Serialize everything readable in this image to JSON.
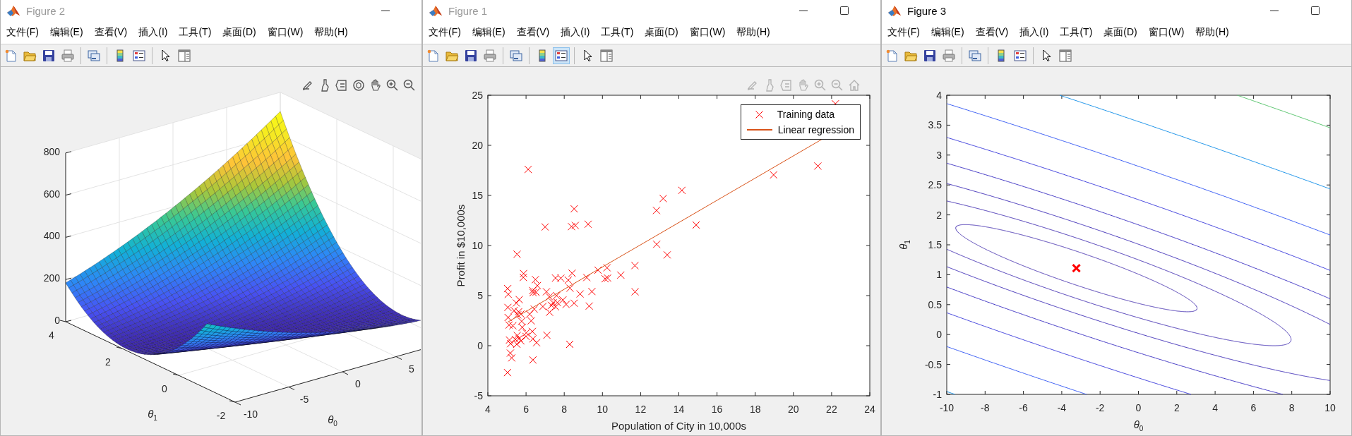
{
  "windows": [
    {
      "title": "Figure 2",
      "active": false,
      "caption_buttons": [
        {
          "kind": "minimize"
        }
      ],
      "menu": [
        "文件(F)",
        "编辑(E)",
        "查看(V)",
        "插入(I)",
        "工具(T)",
        "桌面(D)",
        "窗口(W)",
        "帮助(H)"
      ],
      "toolbar": [
        [
          {
            "kind": "new",
            "selected": false
          },
          {
            "kind": "open",
            "selected": false
          },
          {
            "kind": "save",
            "selected": false
          },
          {
            "kind": "print",
            "selected": false
          }
        ],
        [
          {
            "kind": "link",
            "selected": false
          }
        ],
        [
          {
            "kind": "colorbar",
            "selected": false
          },
          {
            "kind": "legend",
            "selected": false
          }
        ],
        [
          {
            "kind": "pointer",
            "selected": false
          },
          {
            "kind": "property",
            "selected": false
          }
        ]
      ],
      "axes_toolbar": {
        "dimmed": false,
        "tools": [
          {
            "kind": "edit"
          },
          {
            "kind": "brush"
          },
          {
            "kind": "datatip"
          },
          {
            "kind": "rotate"
          },
          {
            "kind": "pan"
          },
          {
            "kind": "zoom-in"
          },
          {
            "kind": "zoom-out"
          }
        ]
      },
      "plot": {
        "kind": "surface",
        "z_ticks": [
          "800",
          "600",
          "400",
          "200",
          "0"
        ],
        "y_ticks": [
          "4",
          "2",
          "0",
          "-2"
        ],
        "x_ticks": [
          "-10",
          "-5",
          "0",
          "5"
        ],
        "xlabel": "*θ*$_{0}$",
        "ylabel": "*θ*$_{1}$"
      }
    },
    {
      "title": "Figure 1",
      "active": false,
      "caption_buttons": [
        {
          "kind": "minimize"
        },
        {
          "kind": "maximize"
        }
      ],
      "menu": [
        "文件(F)",
        "编辑(E)",
        "查看(V)",
        "插入(I)",
        "工具(T)",
        "桌面(D)",
        "窗口(W)",
        "帮助(H)"
      ],
      "toolbar": [
        [
          {
            "kind": "new",
            "selected": false
          },
          {
            "kind": "open",
            "selected": false
          },
          {
            "kind": "save",
            "selected": false
          },
          {
            "kind": "print",
            "selected": false
          }
        ],
        [
          {
            "kind": "link",
            "selected": false
          }
        ],
        [
          {
            "kind": "colorbar",
            "selected": false
          },
          {
            "kind": "legend",
            "selected": true
          }
        ],
        [
          {
            "kind": "pointer",
            "selected": false
          },
          {
            "kind": "property",
            "selected": false
          }
        ]
      ],
      "axes_toolbar": {
        "dimmed": true,
        "tools": [
          {
            "kind": "edit"
          },
          {
            "kind": "brush"
          },
          {
            "kind": "datatip"
          },
          {
            "kind": "pan"
          },
          {
            "kind": "zoom-in"
          },
          {
            "kind": "zoom-out"
          },
          {
            "kind": "home"
          }
        ]
      },
      "plot": {
        "kind": "scatter",
        "chart_data": {
          "type": "scatter",
          "xlabel": "Population of City in 10,000s",
          "ylabel": "Profit in $10,000s",
          "xlim": [
            4,
            24
          ],
          "ylim": [
            -5,
            25
          ],
          "xticks": [
            4,
            6,
            8,
            10,
            12,
            14,
            16,
            18,
            20,
            22,
            24
          ],
          "yticks": [
            -5,
            0,
            5,
            10,
            15,
            20,
            25
          ],
          "series": [
            {
              "name": "Training data",
              "color": "#ff0000",
              "x": [
                6.11,
                5.53,
                8.52,
                7.0,
                5.86,
                8.38,
                8.58,
                6.49,
                5.05,
                14.16,
                5.73,
                8.41,
                5.64,
                5.38,
                6.37,
                5.13,
                6.43,
                7.07,
                6.19,
                5.49,
                5.56,
                12.83,
                10.96,
                13.18,
                22.2,
                5.25,
                6.59,
                9.25,
                8.21,
                7.93,
                8.1,
                5.61,
                12.84,
                6.35,
                6.88,
                11.71,
                5.77,
                7.82,
                7.09,
                5.07,
                5.8,
                11.7,
                5.54,
                7.54,
                7.42,
                7.6,
                6.33,
                6.36,
                6.27,
                5.64,
                9.31,
                9.45,
                8.83,
                5.18,
                21.28,
                14.91,
                18.96,
                7.22,
                8.3,
                10.24,
                10.14,
                7.33,
                6.01,
                7.23,
                5.03,
                6.55,
                7.54,
                5.04,
                10.27,
                5.11,
                5.73,
                5.19,
                6.36,
                9.77,
                6.52,
                8.52,
                9.18,
                6.0,
                5.52,
                5.06,
                7.64,
                5.87,
                5.31,
                8.29,
                13.39,
                5.44
              ],
              "values": [
                17.59,
                9.13,
                13.66,
                11.85,
                6.82,
                11.89,
                12.0,
                6.6,
                3.82,
                15.51,
                3.16,
                7.23,
                0.72,
                3.51,
                5.3,
                0.56,
                3.65,
                5.39,
                3.14,
                4.26,
                3.08,
                13.5,
                7.05,
                14.69,
                24.15,
                -1.22,
                6.0,
                12.13,
                6.54,
                4.56,
                4.12,
                3.39,
                10.12,
                5.5,
                3.91,
                5.39,
                2.44,
                6.73,
                1.05,
                5.13,
                1.84,
                8.0,
                1.02,
                6.75,
                4.29,
                5.0,
                1.42,
                -1.42,
                2.48,
                4.6,
                3.96,
                5.41,
                5.17,
                -0.74,
                17.93,
                12.05,
                17.05,
                4.89,
                5.74,
                7.78,
                6.68,
                4.03,
                1.28,
                3.34,
                -2.68,
                0.3,
                3.88,
                5.7,
                6.75,
                2.06,
                0.48,
                0.2,
                0.68,
                7.54,
                5.34,
                4.24,
                6.8,
                0.93,
                0.15,
                2.82,
                4.3,
                7.2,
                1.99,
                0.14,
                9.06,
                0.62
              ]
            }
          ]
        },
        "fit_line": {
          "name": "Linear regression",
          "color": "#d95319"
        }
      }
    },
    {
      "title": "Figure 3",
      "active": true,
      "caption_buttons": [
        {
          "kind": "minimize"
        },
        {
          "kind": "maximize"
        }
      ],
      "menu": [
        "文件(F)",
        "编辑(E)",
        "查看(V)",
        "插入(I)",
        "工具(T)",
        "桌面(D)",
        "窗口(W)",
        "帮助(H)"
      ],
      "toolbar": [
        [
          {
            "kind": "new",
            "selected": false
          },
          {
            "kind": "open",
            "selected": false
          },
          {
            "kind": "save",
            "selected": false
          },
          {
            "kind": "print",
            "selected": false
          }
        ],
        [
          {
            "kind": "link",
            "selected": false
          }
        ],
        [
          {
            "kind": "colorbar",
            "selected": false
          },
          {
            "kind": "legend",
            "selected": false
          }
        ],
        [
          {
            "kind": "pointer",
            "selected": false
          },
          {
            "kind": "property",
            "selected": false
          }
        ]
      ],
      "plot": {
        "kind": "contour",
        "x_ticks": [
          "-10",
          "-8",
          "-6",
          "-4",
          "-2",
          "0",
          "2",
          "4",
          "6",
          "8",
          "10"
        ],
        "y_ticks": [
          "4",
          "3.5",
          "3",
          "2.5",
          "2",
          "1.5",
          "1",
          "0.5",
          "0",
          "-0.5",
          "-1"
        ],
        "xlabel": "*θ*$_{0}$",
        "ylabel": "*θ*$_{1}$"
      }
    }
  ]
}
